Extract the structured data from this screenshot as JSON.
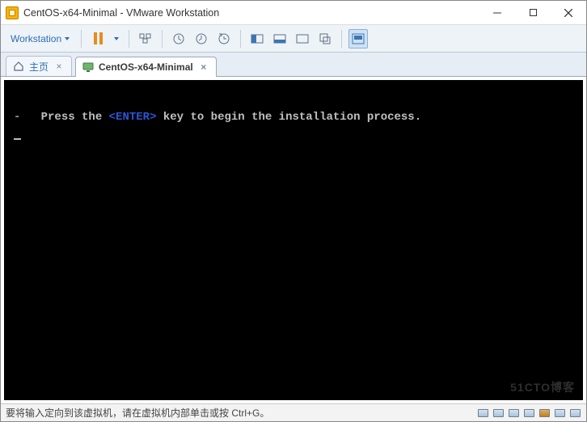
{
  "window": {
    "title": "CentOS-x64-Minimal - VMware Workstation"
  },
  "menu": {
    "workstation": "Workstation"
  },
  "tabs": {
    "home": "主页",
    "vm": "CentOS-x64-Minimal"
  },
  "terminal": {
    "dash": "-",
    "prefix": "Press the ",
    "enter": "<ENTER>",
    "suffix": " key to begin the installation process."
  },
  "statusbar": {
    "message": "要将输入定向到该虚拟机，请在虚拟机内部单击或按 Ctrl+G。"
  },
  "watermark": "51CTO博客"
}
